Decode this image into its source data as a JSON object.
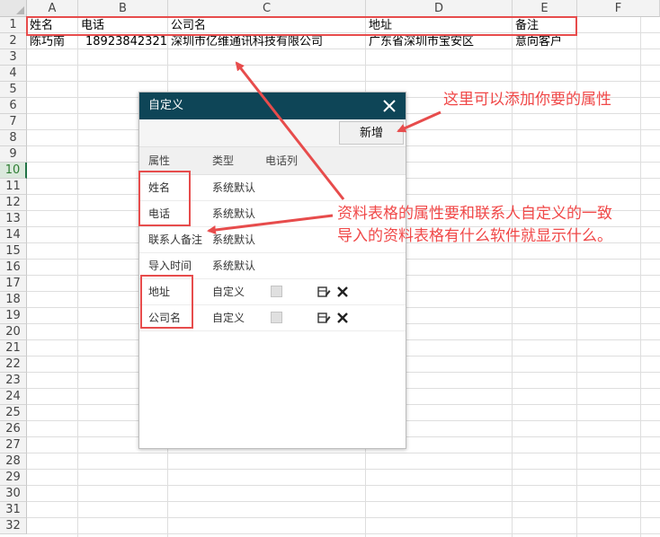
{
  "columns": [
    "A",
    "B",
    "C",
    "D",
    "E",
    "F"
  ],
  "rows": [
    "1",
    "2",
    "3",
    "4",
    "5",
    "6",
    "7",
    "8",
    "9",
    "10",
    "11",
    "12",
    "13",
    "14",
    "15",
    "16",
    "17",
    "18",
    "19",
    "20",
    "21",
    "22",
    "23",
    "24",
    "25",
    "26",
    "27",
    "28",
    "29",
    "30",
    "31",
    "32"
  ],
  "active_row": "10",
  "sheet": {
    "header_row": [
      "姓名",
      "电话",
      "公司名",
      "地址",
      "备注"
    ],
    "data_row": [
      "陈巧南",
      "18923842321",
      "深圳市亿维通讯科技有限公司",
      "广东省深圳市宝安区",
      "意向客户"
    ]
  },
  "dialog": {
    "title": "自定义",
    "new_button": "新增",
    "headers": {
      "attribute": "属性",
      "type": "类型",
      "phone_column": "电话列"
    },
    "rows": [
      {
        "name": "姓名",
        "type": "系统默认"
      },
      {
        "name": "电话",
        "type": "系统默认"
      },
      {
        "name": "联系人备注",
        "type": "系统默认"
      },
      {
        "name": "导入时间",
        "type": "系统默认"
      },
      {
        "name": "地址",
        "type": "自定义"
      },
      {
        "name": "公司名",
        "type": "自定义"
      }
    ]
  },
  "annotations": {
    "add_hint": "这里可以添加你要的属性",
    "match_hint_line1": "资料表格的属性要和联系人自定义的一致",
    "match_hint_line2": "导入的资料表格有什么软件就显示什么。"
  },
  "colors": {
    "title_bar": "#0e4557",
    "annotation_red": "#e74c4c",
    "active_row_green": "#217346"
  },
  "icons": {
    "close": "close-icon",
    "edit": "edit-icon",
    "delete": "delete-icon"
  }
}
